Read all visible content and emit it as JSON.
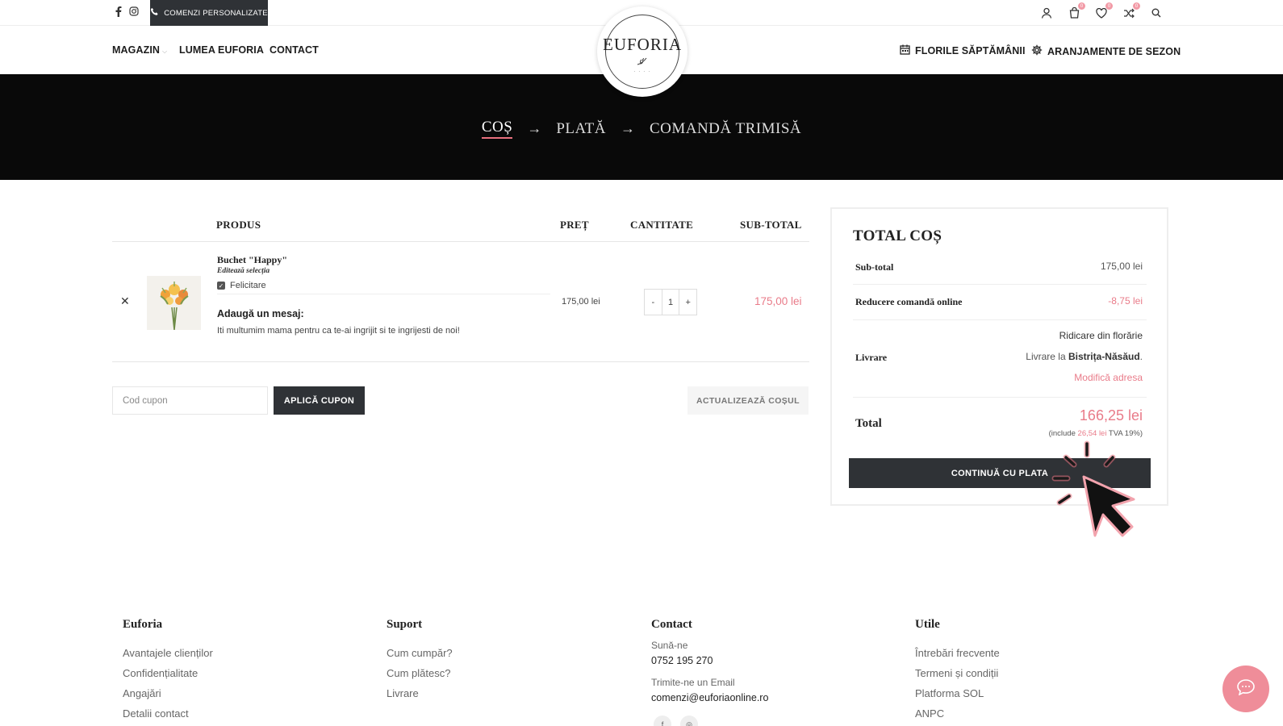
{
  "topbar": {
    "social": [
      "f",
      "ig"
    ],
    "promo_label": "COMENZI PERSONALIZATE",
    "cart_badge": "0",
    "wishlist_badge": "0",
    "compare_badge": "0"
  },
  "nav": {
    "left": [
      "MAGAZIN",
      "LUMEA EUFORIA",
      "CONTACT"
    ],
    "right": [
      "FLORILE SĂPTĂMÂNII",
      "ARANJAMENTE DE SEZON"
    ],
    "logo_text": "EUFORIA"
  },
  "steps": {
    "cart": "COȘ",
    "payment": "PLATĂ",
    "sent": "COMANDĂ TRIMISĂ"
  },
  "table": {
    "headers": {
      "product": "PRODUS",
      "price": "PREȚ",
      "quantity": "CANTITATE",
      "subtotal": "SUB-TOTAL"
    },
    "item": {
      "name": "Buchet \"Happy\"",
      "edit": "Editează selecția",
      "option": "Felicitare",
      "message_label": "Adaugă un mesaj:",
      "message": "Iti multumim mama pentru ca te-ai ingrijit si te ingrijesti de noi!",
      "price": "175,00 lei",
      "quantity": "1",
      "minus": "-",
      "plus": "+",
      "subtotal": "175,00 lei"
    }
  },
  "coupon": {
    "placeholder": "Cod cupon",
    "apply": "APLICĂ CUPON",
    "update": "ACTUALIZEAZĂ COȘUL"
  },
  "totals": {
    "title": "TOTAL COȘ",
    "subtotal_label": "Sub-total",
    "subtotal_value": "175,00 lei",
    "discount_label": "Reducere comandă online",
    "discount_value": "-8,75 lei",
    "shipping_label": "Livrare",
    "shipping_method": "Ridicare din florărie",
    "shipping_to": "Livrare la",
    "shipping_city": "Bistrița-Năsăud",
    "change_address": "Modifică adresa",
    "total_label": "Total",
    "total_value": "166,25 lei",
    "tva_prefix": "(include",
    "tva_amount": "26,54 lei",
    "tva_suffix": "TVA 19%)",
    "checkout": "CONTINUĂ CU PLATA"
  },
  "footer": {
    "col1": {
      "title": "Euforia",
      "links": [
        "Avantajele clienților",
        "Confidențialitate",
        "Angajări",
        "Detalii contact"
      ]
    },
    "col2": {
      "title": "Suport",
      "links": [
        "Cum cumpăr?",
        "Cum plătesc?",
        "Livrare"
      ]
    },
    "col3": {
      "title": "Contact",
      "call_label": "Sună-ne",
      "phone": "0752 195 270",
      "email_label": "Trimite-ne un Email",
      "email": "comenzi@euforiaonline.ro"
    },
    "col4": {
      "title": "Utile",
      "links": [
        "Întrebări frecvente",
        "Termeni și condiții",
        "Platforma SOL",
        "ANPC"
      ]
    }
  },
  "colors": {
    "accent": "#e97b89",
    "dark": "#2f3236",
    "banner": "#090909"
  }
}
